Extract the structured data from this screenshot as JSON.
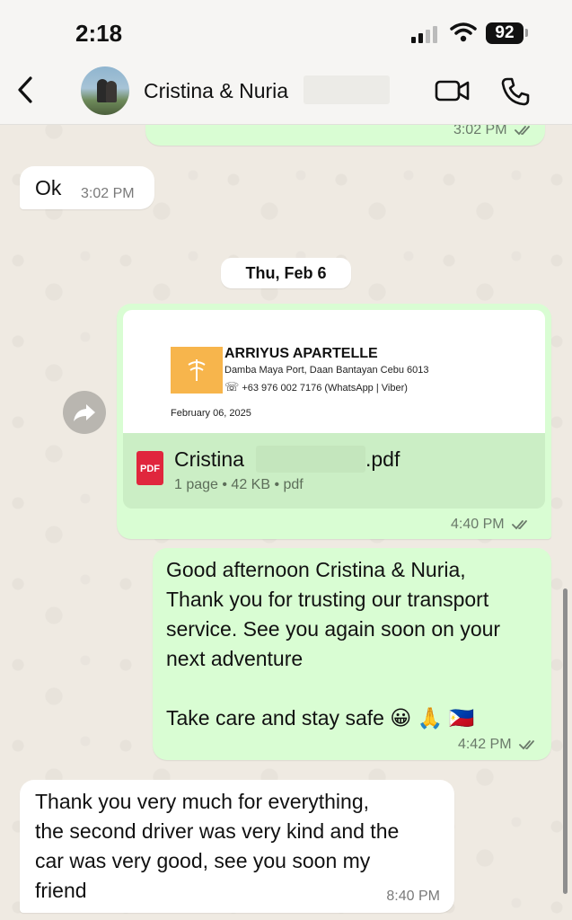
{
  "status_bar": {
    "time": "2:18",
    "battery": "92"
  },
  "header": {
    "contact_name": "Cristina & Nuria"
  },
  "messages": [
    {
      "type": "out",
      "time": "3:02 PM"
    },
    {
      "type": "in",
      "text": "Ok",
      "time": "3:02 PM"
    },
    {
      "type": "date",
      "text": "Thu, Feb 6"
    },
    {
      "type": "out-document",
      "time": "4:40 PM",
      "preview": {
        "company": "ARRIYUS APARTELLE",
        "address": "Damba Maya Port, Daan Bantayan Cebu 6013",
        "phone": "+63 976 002 7176 (WhatsApp | Viber)",
        "date": "February 06, 2025"
      },
      "file": {
        "icon_label": "PDF",
        "name": "Cristina",
        "ext": ".pdf",
        "info": "1 page • 42 KB • pdf"
      }
    },
    {
      "type": "out",
      "text": "Good afternoon Cristina & Nuria,\nThank you for trusting our transport\nservice. See you again soon on your\nnext adventure\n\nTake care and stay safe  😀  🙏  🇵🇭",
      "time": "4:42 PM"
    },
    {
      "type": "in",
      "text": "Thank you very much for everything,\nthe second driver was very kind and the\ncar was very good, see you soon my\nfriend",
      "time": "8:40 PM"
    }
  ],
  "colors": {
    "outgoing_bubble": "#d9fdd3",
    "incoming_bubble": "#ffffff",
    "read_ticks": "#53bdeb",
    "wallpaper": "#efeae2"
  }
}
